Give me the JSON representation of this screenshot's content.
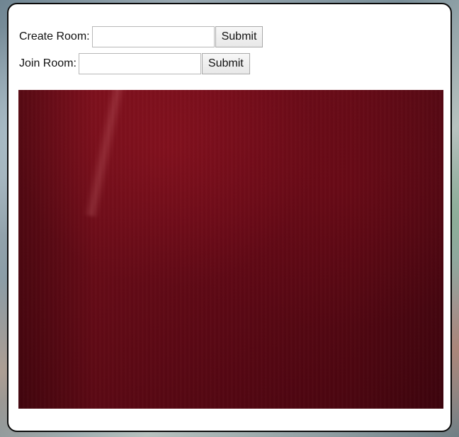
{
  "form": {
    "create": {
      "label": "Create Room:",
      "value": "",
      "placeholder": "",
      "submit_label": "Submit"
    },
    "join": {
      "label": "Join Room:",
      "value": "",
      "placeholder": "",
      "submit_label": "Submit"
    }
  },
  "video": {
    "dominant_color": "#650816"
  }
}
